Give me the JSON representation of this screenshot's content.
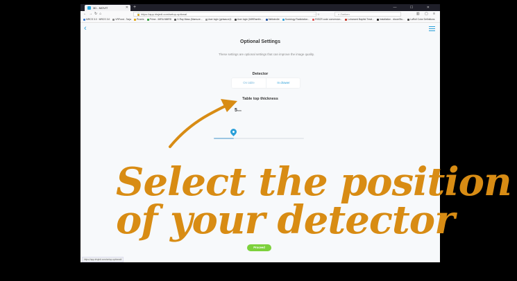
{
  "browser": {
    "tab_title": "3D - MOVIT",
    "new_tab": "+",
    "url": "https://app.irisjedi.com/setup-optional",
    "search_placeholder": "Zoeken",
    "window_controls": "— ☐ ✕",
    "bookmarks": [
      {
        "label": "MRCS 3.0 · MRCS 3.0",
        "color": "#3a7bd5"
      },
      {
        "label": "VRFund - Tarja",
        "color": "#888888"
      },
      {
        "label": "Promis",
        "color": "#e0a000"
      },
      {
        "label": "Prime - IMRA MMRD",
        "color": "#2a9d3a"
      },
      {
        "label": "X-Ray Mass (Mamuze...",
        "color": "#555555"
      },
      {
        "label": "User login (getsauce)1",
        "color": "#999999"
      },
      {
        "label": "User login (MWRamfin...",
        "color": "#444444"
      },
      {
        "label": "Meltwindle",
        "color": "#1d4fa0"
      },
      {
        "label": "Sociology Radiolation...",
        "color": "#2a9fd8"
      },
      {
        "label": "RISCR code conversion...",
        "color": "#e05050"
      },
      {
        "label": "Luhanced Baptist Treat...",
        "color": "#c03020"
      },
      {
        "label": "Installation - dicomStu...",
        "color": "#222222"
      },
      {
        "label": "LaRoll Color Definitions",
        "color": "#444444"
      }
    ]
  },
  "app": {
    "title": "Optional Settings",
    "description": "These settings are optional settings that can improve the image quality.",
    "detector": {
      "heading": "Detector",
      "options": [
        "On table",
        "In drawer"
      ],
      "selected": "In drawer"
    },
    "thickness": {
      "heading": "Table top thickness",
      "value": "5",
      "unit": "mm",
      "level_fraction": 0.22
    },
    "proceed_label": "Proceed"
  },
  "status_url": "https://app.irisjedi.com/setup-optional#",
  "annotation": {
    "line1": "Select the position",
    "line2": "of your detector",
    "color": "#d88c14"
  }
}
